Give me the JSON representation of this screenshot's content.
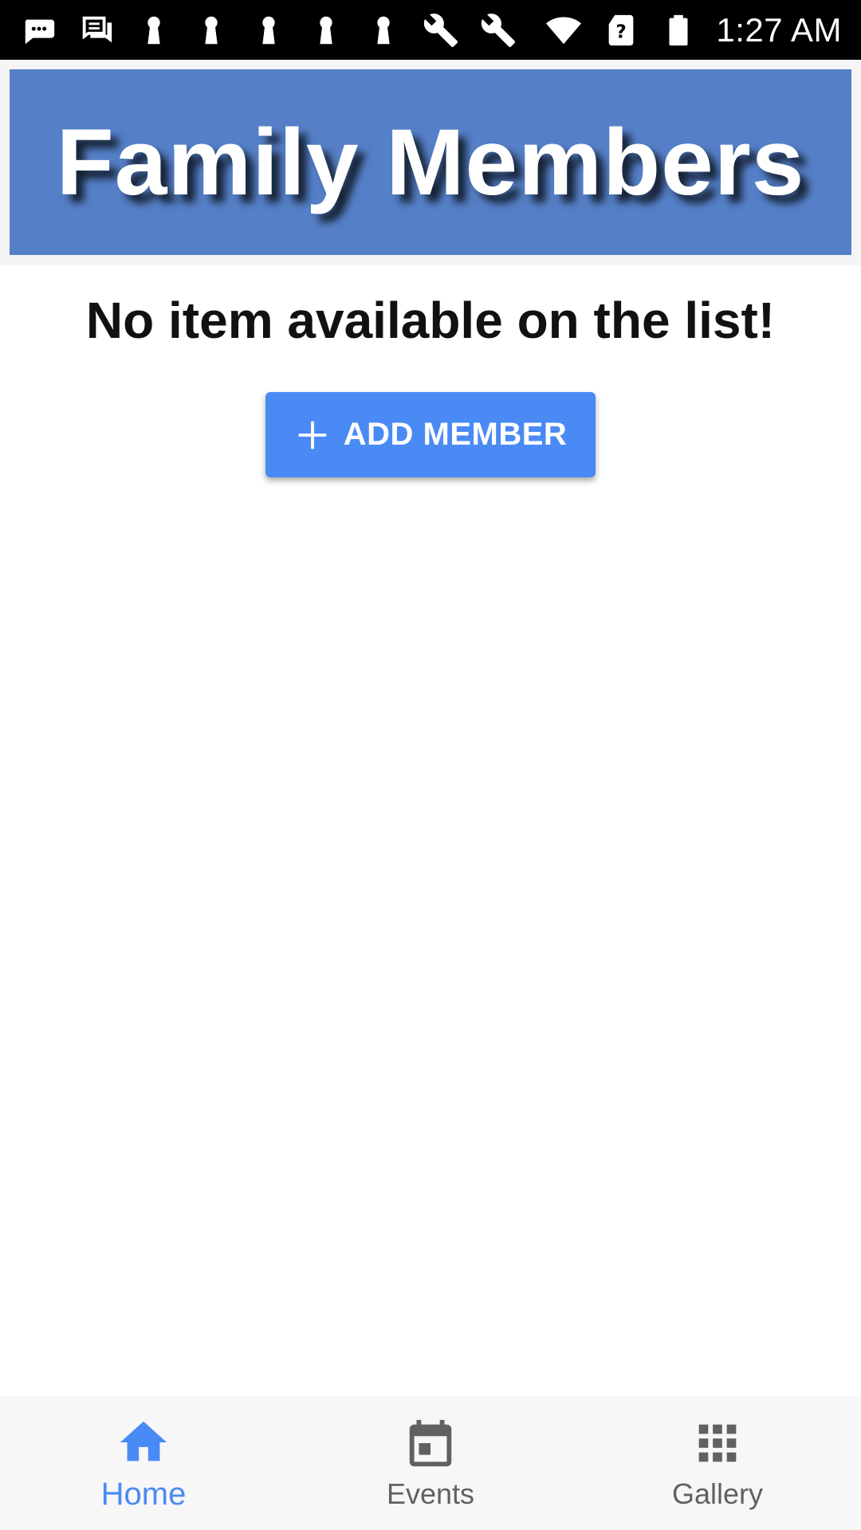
{
  "status_bar": {
    "time": "1:27 AM",
    "icons": [
      "sms-more-icon",
      "chat-icon",
      "keyhole-icon",
      "keyhole-icon",
      "keyhole-icon",
      "keyhole-icon",
      "keyhole-icon",
      "wrench-icon",
      "wrench-icon",
      "wifi-icon",
      "no-sim-icon",
      "battery-icon"
    ]
  },
  "header": {
    "title": "Family Members",
    "color": "#5580c8"
  },
  "main": {
    "empty_message": "No item available on the list!",
    "add_button_label": "ADD MEMBER",
    "add_button_color": "#4a8af4"
  },
  "bottom_nav": {
    "items": [
      {
        "label": "Home",
        "icon": "home-icon",
        "active": true
      },
      {
        "label": "Events",
        "icon": "calendar-icon",
        "active": false
      },
      {
        "label": "Gallery",
        "icon": "grid-icon",
        "active": false
      }
    ],
    "active_color": "#4a8af4",
    "inactive_color": "#616161"
  }
}
